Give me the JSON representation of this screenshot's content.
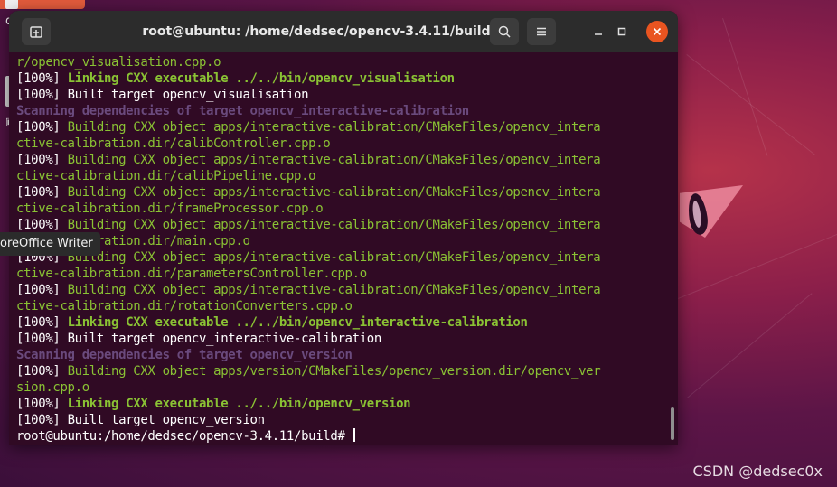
{
  "desktop": {
    "partial_label": "d",
    "tooltip": "oreOffice Writer"
  },
  "watermark": "CSDN @dedsec0x",
  "window": {
    "title": "root@ubuntu: /home/dedsec/opencv-3.4.11/build"
  },
  "terminal": {
    "lines": [
      {
        "style": "g",
        "text": "r/opencv_visualisation.cpp.o"
      },
      {
        "prefix": "[100%] ",
        "style": "gb",
        "text": "Linking CXX executable ../../bin/opencv_visualisation"
      },
      {
        "prefix": "[100%] ",
        "style": "w",
        "text": "Built target opencv_visualisation"
      },
      {
        "style": "pb",
        "text": "Scanning dependencies of target opencv_interactive-calibration"
      },
      {
        "prefix": "[100%] ",
        "style": "g",
        "text": "Building CXX object apps/interactive-calibration/CMakeFiles/opencv_intera"
      },
      {
        "style": "g",
        "text": "ctive-calibration.dir/calibController.cpp.o"
      },
      {
        "prefix": "[100%] ",
        "style": "g",
        "text": "Building CXX object apps/interactive-calibration/CMakeFiles/opencv_intera"
      },
      {
        "style": "g",
        "text": "ctive-calibration.dir/calibPipeline.cpp.o"
      },
      {
        "prefix": "[100%] ",
        "style": "g",
        "text": "Building CXX object apps/interactive-calibration/CMakeFiles/opencv_intera"
      },
      {
        "style": "g",
        "text": "ctive-calibration.dir/frameProcessor.cpp.o"
      },
      {
        "prefix": "[100%] ",
        "style": "g",
        "text": "Building CXX object apps/interactive-calibration/CMakeFiles/opencv_intera"
      },
      {
        "style": "g",
        "text": "ctive-calibration.dir/main.cpp.o"
      },
      {
        "prefix": "[100%] ",
        "style": "g",
        "text": "Building CXX object apps/interactive-calibration/CMakeFiles/opencv_intera"
      },
      {
        "style": "g",
        "text": "ctive-calibration.dir/parametersController.cpp.o"
      },
      {
        "prefix": "[100%] ",
        "style": "g",
        "text": "Building CXX object apps/interactive-calibration/CMakeFiles/opencv_intera"
      },
      {
        "style": "g",
        "text": "ctive-calibration.dir/rotationConverters.cpp.o"
      },
      {
        "prefix": "[100%] ",
        "style": "gb",
        "text": "Linking CXX executable ../../bin/opencv_interactive-calibration"
      },
      {
        "prefix": "[100%] ",
        "style": "w",
        "text": "Built target opencv_interactive-calibration"
      },
      {
        "style": "pb",
        "text": "Scanning dependencies of target opencv_version"
      },
      {
        "prefix": "[100%] ",
        "style": "g",
        "text": "Building CXX object apps/version/CMakeFiles/opencv_version.dir/opencv_ver"
      },
      {
        "style": "g",
        "text": "sion.cpp.o"
      },
      {
        "prefix": "[100%] ",
        "style": "gb",
        "text": "Linking CXX executable ../../bin/opencv_version"
      },
      {
        "prefix": "[100%] ",
        "style": "w",
        "text": "Built target opencv_version"
      }
    ],
    "prompt": "root@ubuntu:/home/dedsec/opencv-3.4.11/build# "
  },
  "icons": {
    "new_tab": "new-tab-icon",
    "search": "search-icon",
    "menu": "hamburger-menu-icon",
    "minimize": "minimize-icon",
    "maximize": "maximize-icon",
    "close": "close-icon"
  },
  "colors": {
    "terminal_bg": "#300a24",
    "green": "#8ac234",
    "purple": "#6a4a7d",
    "close": "#e95420"
  }
}
